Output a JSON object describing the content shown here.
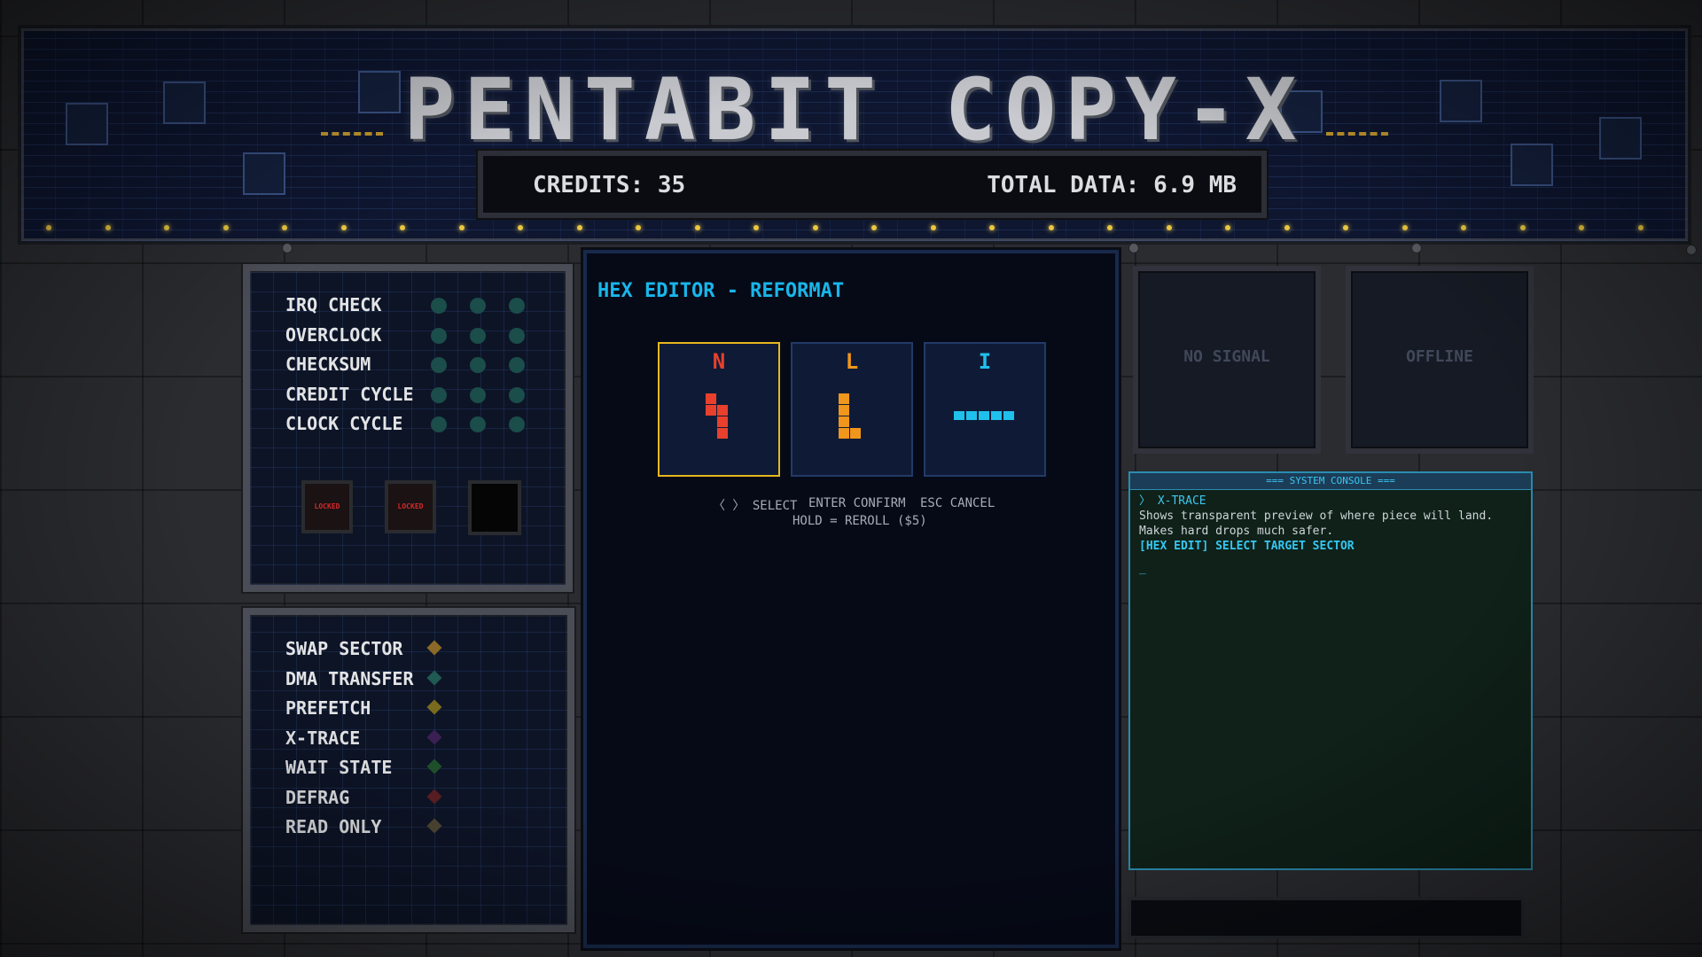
{
  "header": {
    "title": "PENTABIT COPY-X",
    "credits_text": "CREDITS: 35",
    "total_data_text": "TOTAL DATA: 6.9 MB"
  },
  "system_panel": {
    "items": [
      {
        "label": "IRQ CHECK"
      },
      {
        "label": "OVERCLOCK"
      },
      {
        "label": "CHECKSUM"
      },
      {
        "label": "CREDIT CYCLE"
      },
      {
        "label": "CLOCK CYCLE"
      }
    ],
    "slots": [
      {
        "label": "LOCKED"
      },
      {
        "label": "LOCKED"
      },
      {
        "label": ""
      }
    ]
  },
  "ability_panel": {
    "items": [
      {
        "label": "SWAP SECTOR",
        "color": "#8a6a26"
      },
      {
        "label": "DMA TRANSFER",
        "color": "#1f5a53"
      },
      {
        "label": "PREFETCH",
        "color": "#7a6a1f"
      },
      {
        "label": "X-TRACE",
        "color": "#3a2053"
      },
      {
        "label": "WAIT STATE",
        "color": "#1f4f2a"
      },
      {
        "label": "DEFRAG",
        "color": "#5a1f22"
      },
      {
        "label": "READ ONLY",
        "color": "#4d4633"
      }
    ]
  },
  "editor": {
    "title": "HEX EDITOR - REFORMAT",
    "cards": [
      {
        "letter": "N",
        "color": "#e8402c",
        "selected": true
      },
      {
        "letter": "L",
        "color": "#f0961c",
        "selected": false
      },
      {
        "letter": "I",
        "color": "#20c0ec",
        "selected": false
      }
    ],
    "controls": {
      "select": "〈 〉 SELECT",
      "confirm": "ENTER CONFIRM",
      "cancel": "ESC CANCEL",
      "reroll": "HOLD = REROLL ($5)"
    }
  },
  "monitors": {
    "left": "NO SIGNAL",
    "right": "OFFLINE"
  },
  "console": {
    "header": "=== SYSTEM CONSOLE ===",
    "line1": "〉 X-TRACE",
    "line2": "Shows transparent preview of where piece will land. Makes hard drops much safer.",
    "line3": "[HEX EDIT] SELECT TARGET SECTOR",
    "cursor": "_"
  }
}
